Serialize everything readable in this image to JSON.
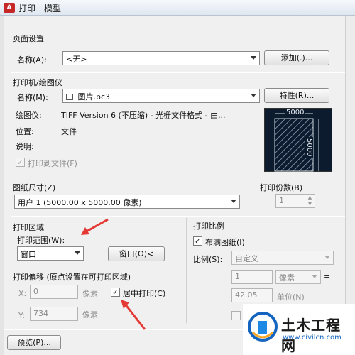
{
  "window": {
    "title": "打印 - 模型",
    "app_icon": "A"
  },
  "page_setup": {
    "section": "页面设置",
    "name_label": "名称(A):",
    "name_value": "<无>",
    "add_button": "添加(.)..."
  },
  "printer": {
    "section": "打印机/绘图仪",
    "name_label": "名称(M):",
    "name_value": "图片.pc3",
    "properties_button": "特性(R)...",
    "plotter_label": "绘图仪:",
    "plotter_value": "TIFF Version 6 (不压缩) - 光栅文件格式 - 由...",
    "location_label": "位置:",
    "location_value": "文件",
    "description_label": "说明:",
    "print_to_file_label": "打印到文件(F)",
    "preview_width": "5000",
    "preview_height": "5000"
  },
  "paper_size": {
    "section": "图纸尺寸(Z)",
    "value": "用户 1 (5000.00 x 5000.00 像素)"
  },
  "copies": {
    "section": "打印份数(B)",
    "value": "1"
  },
  "plot_area": {
    "section": "打印区域",
    "range_label": "打印范围(W):",
    "range_value": "窗口",
    "window_button": "窗口(O)<"
  },
  "plot_offset": {
    "section": "打印偏移 (原点设置在可打印区域)",
    "x_label": "X:",
    "x_value": "0",
    "x_unit": "像素",
    "y_label": "Y:",
    "y_value": "734",
    "y_unit": "像素",
    "center_label": "居中打印(C)"
  },
  "plot_scale": {
    "section": "打印比例",
    "fit_label": "布满图纸(I)",
    "scale_label": "比例(S):",
    "scale_value": "自定义",
    "value1": "1",
    "unit1": "像素",
    "equals": "=",
    "value2": "42.05",
    "unit2_label": "单位(N)"
  },
  "footer": {
    "preview_button": "预览(P)..."
  },
  "watermark": {
    "title": "土木工程网",
    "url": "www.civilcn.com"
  },
  "colors": {
    "annotation_arrow": "#e53935",
    "preview_bg": "#0d1b2e"
  }
}
